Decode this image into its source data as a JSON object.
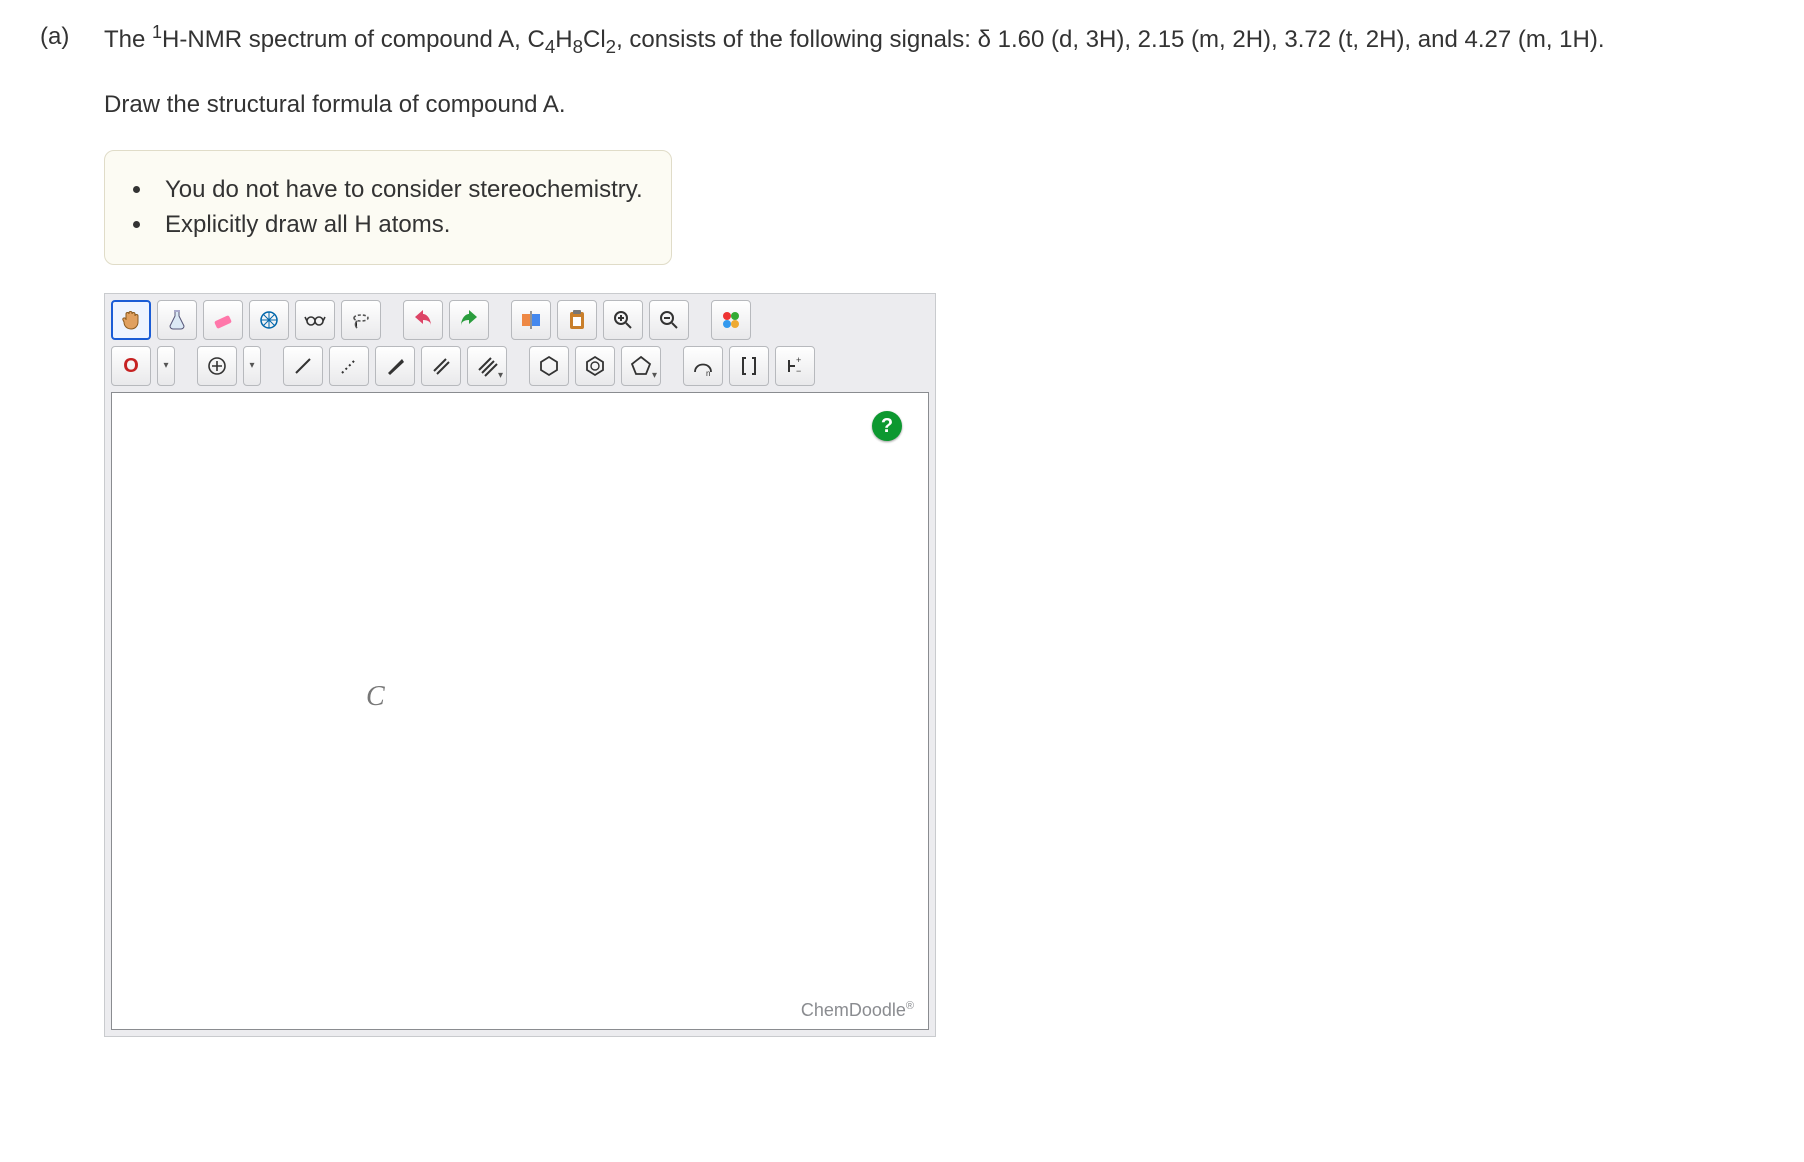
{
  "part": "(a)",
  "question_html": "The <sup>1</sup>H-NMR spectrum of compound A, C<sub>4</sub>H<sub>8</sub>Cl<sub>2</sub>, consists of the following signals: δ 1.60 (d, 3H), 2.15 (m, 2H), 3.72 (t, 2H), and 4.27 (m, 1H).",
  "prompt": "Draw the structural formula of compound A.",
  "notes": [
    "You do not have to consider stereochemistry.",
    "Explicitly draw all H atoms."
  ],
  "toolbar": {
    "row1": {
      "hand": "hand-icon",
      "flask": "flask-icon",
      "eraser": "eraser-icon",
      "centroid": "centroid-icon",
      "glasses": "glasses-icon",
      "lasso": "lasso-icon",
      "undo": "undo-icon",
      "redo": "redo-icon",
      "flip": "flip-icon",
      "paste": "paste-icon",
      "zoomin": "zoom-in-icon",
      "zoomout": "zoom-out-icon",
      "colors": "color-icon"
    },
    "row2": {
      "oxygen": "O",
      "plus": "plus-icon",
      "bond": "bond-icon",
      "dotted": "dotted-bond-icon",
      "wedge": "wedge-icon",
      "dbond": "double-bond-icon",
      "tbond": "triple-bond-icon",
      "hex": "hexagon-icon",
      "hexd": "benzene-icon",
      "pent": "pentagon-icon",
      "curve": "curve-icon",
      "bracket": "bracket-icon",
      "charge": "charge-icon"
    }
  },
  "canvas": {
    "element": "C"
  },
  "help": "?",
  "watermark": "ChemDoodle"
}
